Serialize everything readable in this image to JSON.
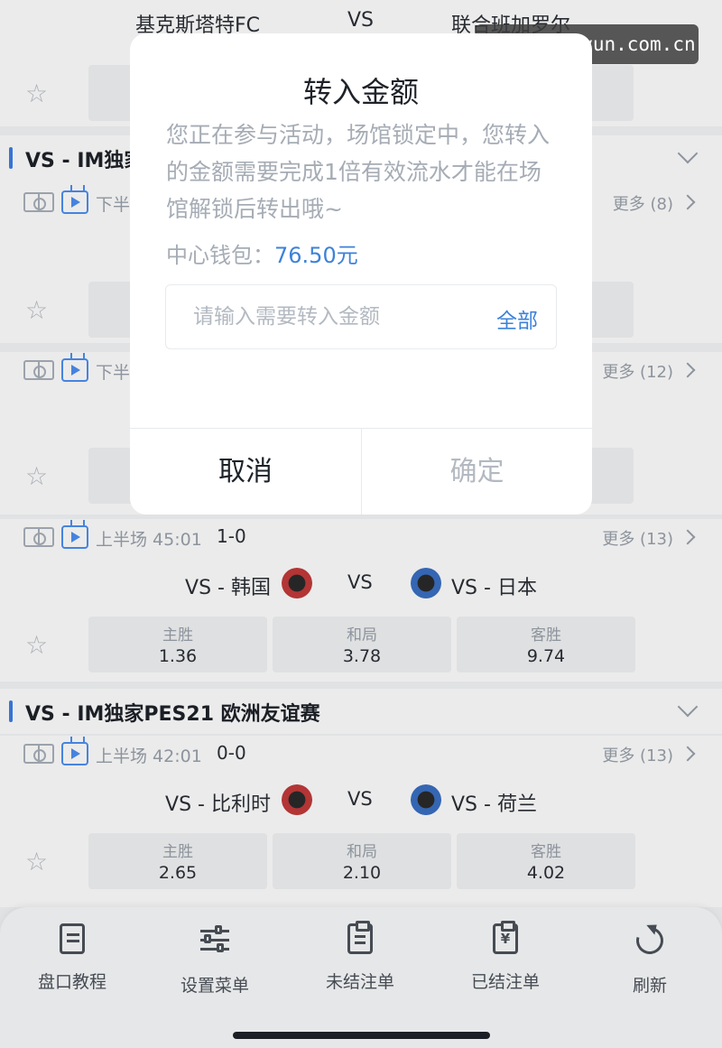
{
  "watermark": "unlockkaiyun.com.cn",
  "top_match": {
    "home": "基克斯塔特FC",
    "away": "联合班加罗尔",
    "vs": "VS"
  },
  "league1": {
    "title": "VS - IM独家"
  },
  "hidden_match1": {
    "period": "下半",
    "more": "更多 (8)"
  },
  "hidden_match2": {
    "period": "下半",
    "more": "更多 (12)"
  },
  "match3": {
    "period": "上半场 45:01",
    "score": "1-0",
    "more": "更多 (13)",
    "home": "VS - 韩国",
    "away": "VS - 日本",
    "vs": "VS",
    "odds": [
      {
        "label": "主胜",
        "value": "1.36"
      },
      {
        "label": "和局",
        "value": "3.78"
      },
      {
        "label": "客胜",
        "value": "9.74"
      }
    ]
  },
  "league2": {
    "title": "VS - IM独家PES21 欧洲友谊赛"
  },
  "match4": {
    "period": "上半场 42:01",
    "score": "0-0",
    "more": "更多 (13)",
    "home": "VS - 比利时",
    "away": "VS - 荷兰",
    "vs": "VS",
    "odds": [
      {
        "label": "主胜",
        "value": "2.65"
      },
      {
        "label": "和局",
        "value": "2.10"
      },
      {
        "label": "客胜",
        "value": "4.02"
      }
    ]
  },
  "nav": [
    {
      "label": "盘口教程",
      "icon": "doc-icon"
    },
    {
      "label": "设置菜单",
      "icon": "sliders-icon"
    },
    {
      "label": "未结注单",
      "icon": "clipboard-icon"
    },
    {
      "label": "已结注单",
      "icon": "yen-clipboard-icon"
    },
    {
      "label": "刷新",
      "icon": "refresh-icon"
    }
  ],
  "dialog": {
    "title": "转入金额",
    "message": "您正在参与活动，场馆锁定中，您转入的金额需要完成1倍有效流水才能在场馆解锁后转出哦~",
    "wallet_label": "中心钱包：",
    "wallet_amount": "76.50元",
    "input_placeholder": "请输入需要转入金额",
    "all_label": "全部",
    "cancel_label": "取消",
    "confirm_label": "确定"
  },
  "colors": {
    "accent": "#3c82d9",
    "league_bar": "#3d7ee6",
    "crest_home": "#c33a3a",
    "crest_away": "#3a6fc3"
  }
}
